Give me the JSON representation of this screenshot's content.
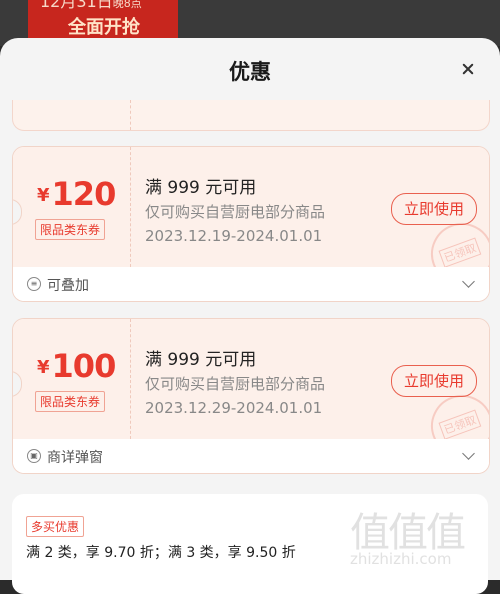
{
  "background": {
    "banner_line1": "12月31日",
    "banner_line1_suffix": "晚8点",
    "banner_line2": "全面开抢"
  },
  "sheet": {
    "title": "优惠"
  },
  "coupons": [
    {
      "currency": "¥",
      "amount": "120",
      "tag": "限品类东券",
      "condition": "满 999 元可用",
      "description": "仅可购买自营厨电部分商品",
      "date_range": "2023.12.19-2024.01.01",
      "button": "立即使用",
      "stamp": "已领取",
      "footer": "可叠加",
      "footer_icon": "stack-icon"
    },
    {
      "currency": "¥",
      "amount": "100",
      "tag": "限品类东券",
      "condition": "满 999 元可用",
      "description": "仅可购买自营厨电部分商品",
      "date_range": "2023.12.29-2024.01.01",
      "button": "立即使用",
      "stamp": "已领取",
      "footer": "商详弹窗",
      "footer_icon": "popup-icon"
    }
  ],
  "multibuy": {
    "tag": "多买优惠",
    "text": "满 2 类，享 9.70 折；满 3 类，享 9.50 折"
  },
  "watermark": {
    "glyphs": "值值值",
    "text": "zhizhizhi.com"
  },
  "colors": {
    "accent": "#e83a2e",
    "coupon_bg": "#fdf0ea"
  }
}
